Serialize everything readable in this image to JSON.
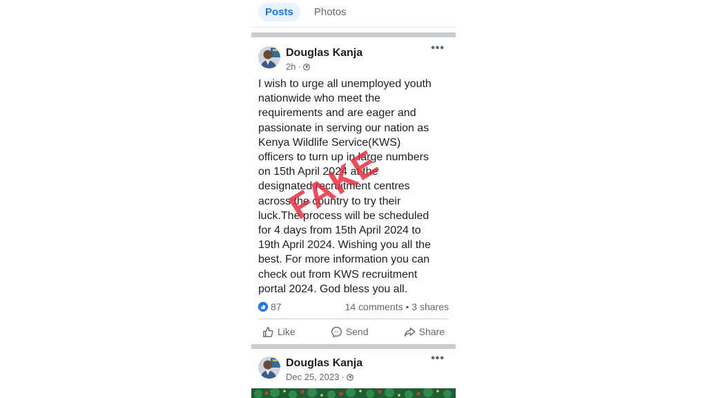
{
  "tabs": [
    {
      "label": "Posts",
      "active": true
    },
    {
      "label": "Photos",
      "active": false
    }
  ],
  "post1": {
    "author": "Douglas Kanja",
    "time": "2h",
    "more": "•••",
    "lines": [
      "I wish to urge all unemployed youth",
      "nationwide who meet the",
      "requirements and are eager and",
      "passionate in serving our nation as",
      "Kenya Wildlife Service(KWS)",
      "officers to turn up in large numbers",
      "on 15th April 2024 at the",
      "designated recruitment centres",
      "across the country to try their",
      "luck.The process will be scheduled",
      "for 4 days from 15th April 2024 to",
      "19th April 2024. Wishing you all the",
      "best. For more information you can",
      "check out from KWS recruitment",
      "portal 2024. God bless you all."
    ],
    "stamp": "FAKE",
    "reactions": "87",
    "comments_shares": "14 comments • 3 shares",
    "actions": {
      "like": "Like",
      "send": "Send",
      "share": "Share"
    }
  },
  "post2": {
    "author": "Douglas Kanja",
    "time": "Dec 25, 2023",
    "more": "•••"
  },
  "colors": {
    "accent": "#1877f2",
    "stamp": "#e62837",
    "separator": "#c9ccd1"
  }
}
